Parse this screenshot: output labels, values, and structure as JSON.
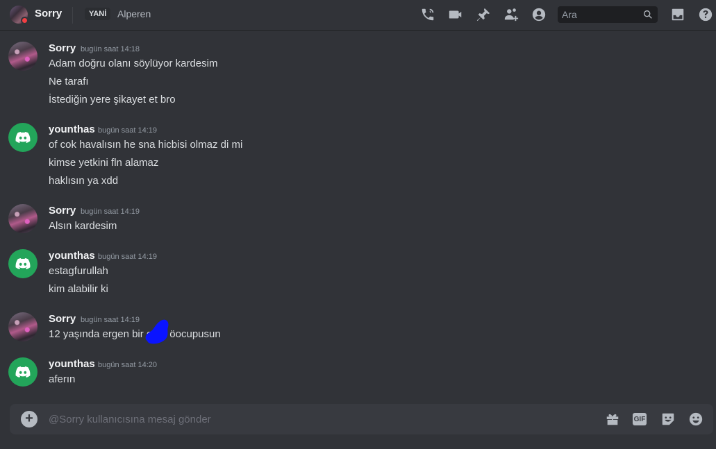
{
  "header": {
    "name": "Sorry",
    "tag": "YANİ",
    "status": "Alperen",
    "search_placeholder": "Ara",
    "icons": [
      "voice-call-icon",
      "video-call-icon",
      "pin-icon",
      "add-friends-icon",
      "profile-icon",
      "search-icon",
      "inbox-icon",
      "help-icon"
    ]
  },
  "messages": [
    {
      "author": "Sorry",
      "timestamp": "bugün saat 14:18",
      "lines": [
        "Adam doğru olanı söylüyor kardesim",
        "Ne tarafı",
        "İstediğin yere şikayet et bro"
      ]
    },
    {
      "author": "younthas",
      "timestamp": "bugün saat 14:19",
      "lines": [
        "of cok havalısın he sna hicbisi olmaz di mi",
        "kimse yetkini fln alamaz",
        "haklısın ya xdd"
      ]
    },
    {
      "author": "Sorry",
      "timestamp": "bugün saat 14:19",
      "lines": [
        "Alsın kardesim"
      ]
    },
    {
      "author": "younthas",
      "timestamp": "bugün saat 14:19",
      "lines": [
        "estagfurullah",
        "kim alabilir ki"
      ]
    },
    {
      "author": "Sorry",
      "timestamp": "bugün saat 14:19",
      "lines": [
        "12 yaşında ergen bir o    pu öocupusun"
      ]
    },
    {
      "author": "younthas",
      "timestamp": "bugün saat 14:20",
      "lines": [
        "aferın"
      ]
    }
  ],
  "composer": {
    "placeholder": "@Sorry kullanıcısına mesaj gönder",
    "gif_label": "GIF"
  },
  "colors": {
    "background": "#313338",
    "composer": "#383a40",
    "discord_green": "#23a55a",
    "dnd_red": "#f23f43"
  }
}
